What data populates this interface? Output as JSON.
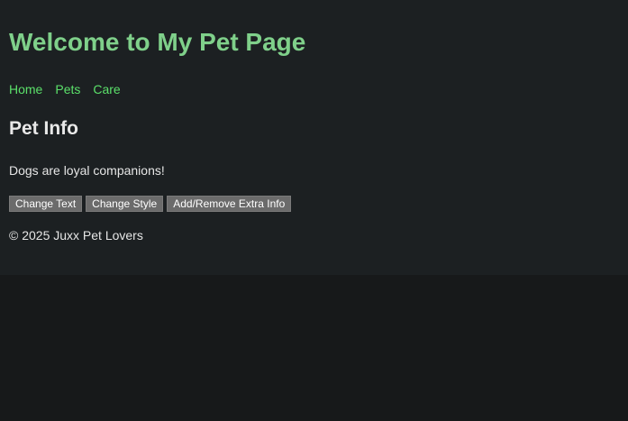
{
  "header": {
    "title": "Welcome to My Pet Page"
  },
  "nav": {
    "items": [
      {
        "label": "Home"
      },
      {
        "label": "Pets"
      },
      {
        "label": "Care"
      }
    ]
  },
  "section": {
    "title": "Pet Info",
    "text": "Dogs are loyal companions!"
  },
  "buttons": {
    "change_text": "Change Text",
    "change_style": "Change Style",
    "toggle_extra": "Add/Remove Extra Info"
  },
  "footer": {
    "text": "© 2025 Juxx Pet Lovers"
  },
  "colors": {
    "background": "#1c2022",
    "outer_background": "#17191a",
    "title": "#7fd08a",
    "link": "#5be06a",
    "text": "#e6e6e6",
    "button": "#6b6b6b"
  }
}
